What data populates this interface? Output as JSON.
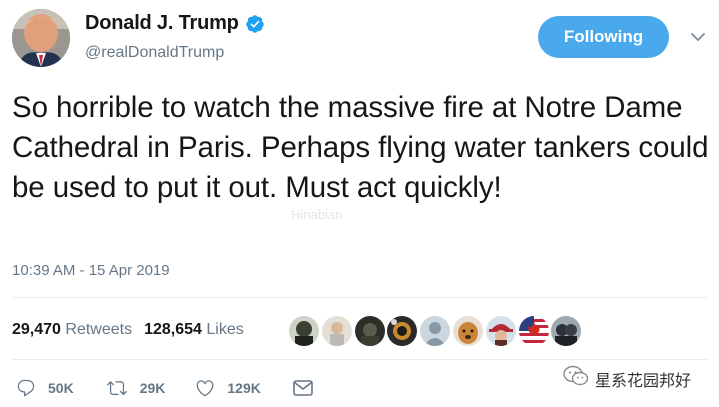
{
  "header": {
    "display_name": "Donald J. Trump",
    "handle": "@realDonaldTrump",
    "follow_label": "Following",
    "verified_icon": "verified-badge-icon",
    "caret_icon": "chevron-down-icon",
    "accent_color": "#4aa9ec"
  },
  "tweet": {
    "text": "So horrible to watch the massive fire at Notre Dame Cathedral in Paris. Perhaps flying water tankers could be used to put it out. Must act quickly!",
    "timestamp": "10:39 AM - 15 Apr 2019"
  },
  "stats": {
    "retweets_count": "29,470",
    "retweets_label": "Retweets",
    "likes_count": "128,654",
    "likes_label": "Likes"
  },
  "actions": {
    "reply_count": "50K",
    "retweet_count": "29K",
    "like_count": "129K",
    "reply_icon": "reply-icon",
    "retweet_icon": "retweet-icon",
    "like_icon": "heart-icon",
    "dm_icon": "envelope-icon"
  },
  "watermarks": {
    "mid_text": "Hinabian",
    "wechat_text": "星系花园邦好",
    "wechat_icon": "wechat-icon"
  }
}
